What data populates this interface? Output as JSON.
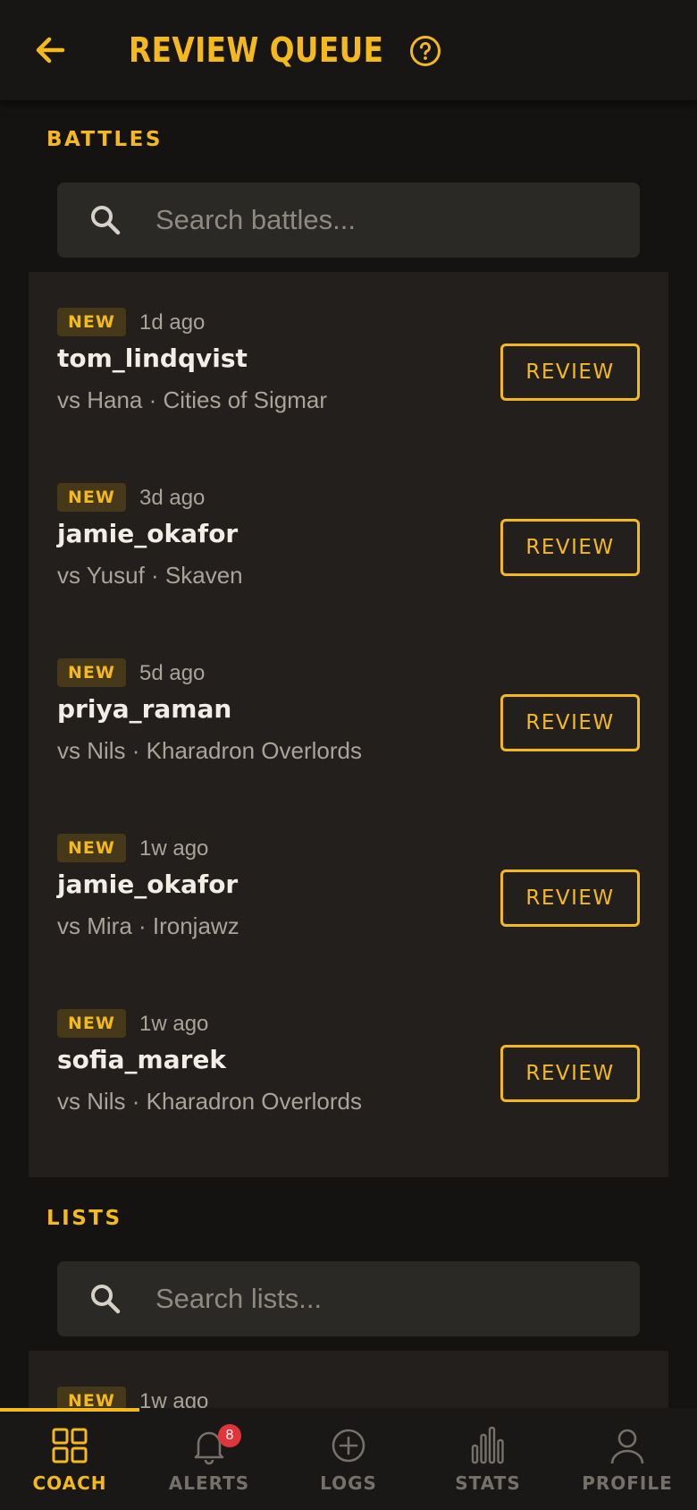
{
  "header": {
    "title": "REVIEW QUEUE"
  },
  "battles": {
    "title": "BATTLES",
    "search_placeholder": "Search battles...",
    "items": [
      {
        "badge": "NEW",
        "age": "1d ago",
        "user": "tom_lindqvist",
        "match": "vs Hana · Cities of Sigmar",
        "action": "REVIEW"
      },
      {
        "badge": "NEW",
        "age": "3d ago",
        "user": "jamie_okafor",
        "match": "vs Yusuf · Skaven",
        "action": "REVIEW"
      },
      {
        "badge": "NEW",
        "age": "5d ago",
        "user": "priya_raman",
        "match": "vs Nils · Kharadron Overlords",
        "action": "REVIEW"
      },
      {
        "badge": "NEW",
        "age": "1w ago",
        "user": "jamie_okafor",
        "match": "vs Mira · Ironjawz",
        "action": "REVIEW"
      },
      {
        "badge": "NEW",
        "age": "1w ago",
        "user": "sofia_marek",
        "match": "vs Nils · Kharadron Overlords",
        "action": "REVIEW"
      }
    ]
  },
  "lists": {
    "title": "LISTS",
    "search_placeholder": "Search lists...",
    "items": [
      {
        "badge": "NEW",
        "age": "1w ago"
      }
    ]
  },
  "nav": {
    "items": [
      {
        "label": "COACH",
        "icon": "grid-icon",
        "active": true
      },
      {
        "label": "ALERTS",
        "icon": "bell-icon",
        "badge": "8"
      },
      {
        "label": "LOGS",
        "icon": "plus-circle-icon"
      },
      {
        "label": "STATS",
        "icon": "bar-chart-icon"
      },
      {
        "label": "PROFILE",
        "icon": "user-icon"
      }
    ]
  },
  "colors": {
    "accent": "#f5b91c",
    "background": "#141311",
    "panel": "#221f1c",
    "badge_alert": "#e0353b"
  }
}
